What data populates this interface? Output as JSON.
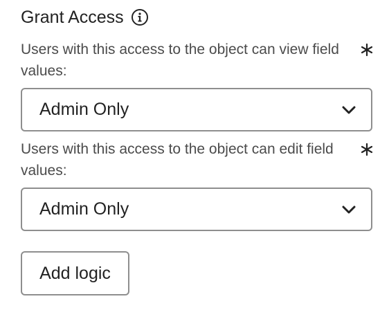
{
  "section": {
    "title": "Grant Access",
    "info_icon": "info-icon"
  },
  "view_field": {
    "label": "Users with this access to the object can view field values:",
    "required_icon": "asterisk-icon",
    "selected": "Admin Only",
    "chevron_icon": "chevron-down-icon"
  },
  "edit_field": {
    "label": "Users with this access to the object can edit field values:",
    "required_icon": "asterisk-icon",
    "selected": "Admin Only",
    "chevron_icon": "chevron-down-icon"
  },
  "add_logic": {
    "label": "Add logic"
  },
  "colors": {
    "text": "#222222",
    "label": "#4b4b4b",
    "border": "#8e8e8e",
    "background": "#ffffff"
  }
}
